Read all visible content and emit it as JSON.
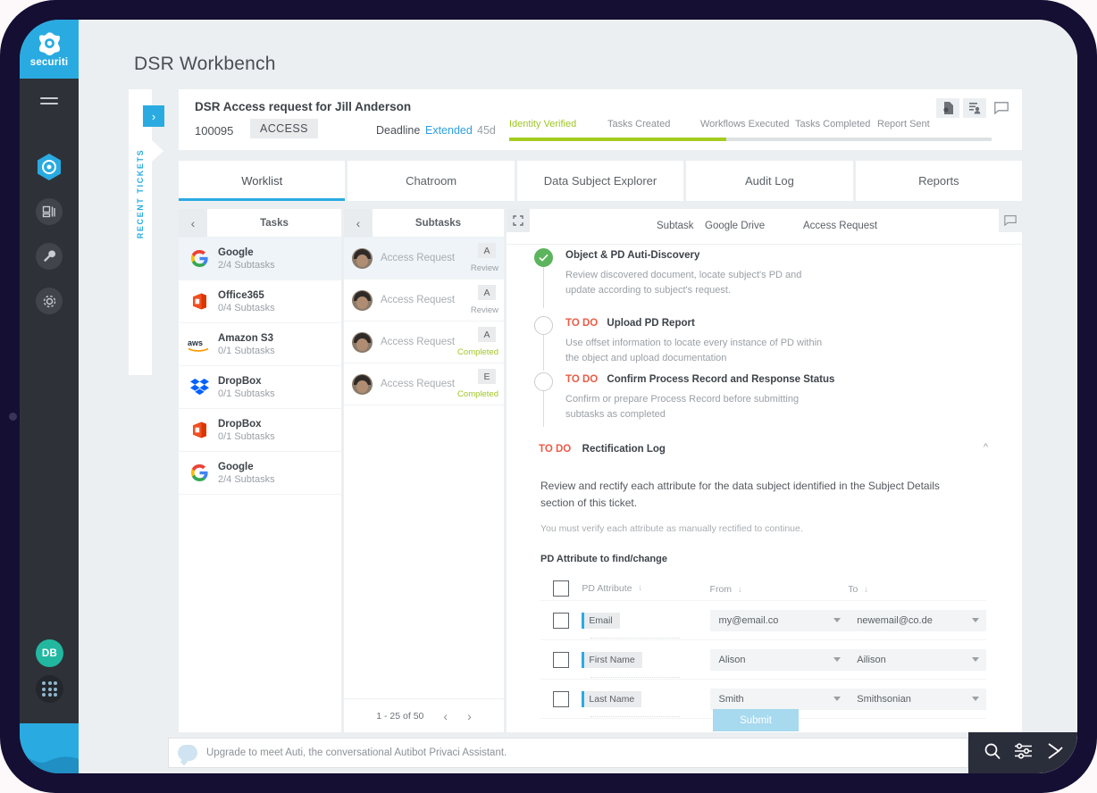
{
  "brand": {
    "name": "securiti",
    "logo_icon": "securiti-logo-icon"
  },
  "sidebar": {
    "menu_icon": "hamburger-menu-icon",
    "items": [
      {
        "icon": "privaci-hexagon-icon",
        "active": true
      },
      {
        "icon": "dashboard-icon",
        "active": false
      },
      {
        "icon": "wrench-icon",
        "active": false
      },
      {
        "icon": "gear-icon",
        "active": false
      }
    ],
    "avatar_initials": "DB",
    "apps_icon": "apps-grid-icon"
  },
  "page": {
    "title": "DSR Workbench"
  },
  "rail": {
    "label": "RECENT TICKETS",
    "expand_icon": "chevron-right-icon"
  },
  "ticket": {
    "title": "DSR Access request for Jill Anderson",
    "id": "100095",
    "type": "ACCESS",
    "deadline_label": "Deadline",
    "deadline_state": "Extended",
    "deadline_days": "45d",
    "icons": [
      "document-settings-icon",
      "assign-user-icon",
      "comment-icon"
    ],
    "stepper": {
      "steps": [
        {
          "label": "Identity Verified",
          "done": true
        },
        {
          "label": "Tasks Created",
          "done": false
        },
        {
          "label": "Workflows Executed",
          "done": false
        },
        {
          "label": "Tasks Completed",
          "done": false
        },
        {
          "label": "Report Sent",
          "done": false
        }
      ],
      "progress_percent": 45
    }
  },
  "tabs": [
    {
      "label": "Worklist",
      "active": true
    },
    {
      "label": "Chatroom",
      "active": false
    },
    {
      "label": "Data Subject Explorer",
      "active": false
    },
    {
      "label": "Audit Log",
      "active": false
    },
    {
      "label": "Reports",
      "active": false
    }
  ],
  "tasks_panel": {
    "header": "Tasks",
    "back_icon": "chevron-left-icon",
    "rows": [
      {
        "name": "Google",
        "subtasks": "2/4 Subtasks",
        "icon": "google-icon",
        "selected": true
      },
      {
        "name": "Office365",
        "subtasks": "0/4 Subtasks",
        "icon": "office365-icon",
        "selected": false
      },
      {
        "name": "Amazon S3",
        "subtasks": "0/1 Subtasks",
        "icon": "aws-icon",
        "selected": false
      },
      {
        "name": "DropBox",
        "subtasks": "0/1 Subtasks",
        "icon": "dropbox-icon",
        "selected": false
      },
      {
        "name": "DropBox",
        "subtasks": "0/1 Subtasks",
        "icon": "office365-icon",
        "selected": false
      },
      {
        "name": "Google",
        "subtasks": "2/4 Subtasks",
        "icon": "google-icon",
        "selected": false
      }
    ]
  },
  "subtasks_panel": {
    "header": "Subtasks",
    "back_icon": "chevron-left-icon",
    "rows": [
      {
        "name": "Access Request",
        "badge": "A",
        "status": "Review",
        "done": false,
        "selected": true
      },
      {
        "name": "Access Request",
        "badge": "A",
        "status": "Review",
        "done": false,
        "selected": false
      },
      {
        "name": "Access Request",
        "badge": "A",
        "status": "Completed",
        "done": true,
        "selected": false
      },
      {
        "name": "Access Request",
        "badge": "E",
        "status": "Completed",
        "done": true,
        "selected": false
      }
    ],
    "pagination": {
      "range": "1 - 25 of 50",
      "prev_icon": "chevron-left-icon",
      "next_icon": "chevron-right-icon"
    }
  },
  "detail": {
    "expand_icon": "fullscreen-expand-icon",
    "chat_icon": "comment-icon",
    "breadcrumb": {
      "subtask": "Subtask",
      "source": "Google Drive",
      "type": "Access Request"
    },
    "checklist": [
      {
        "title": "Object & PD Auti-Discovery",
        "todo": "",
        "desc": "Review discovered document, locate subject's PD and update according to subject's request.",
        "done": true
      },
      {
        "title": "Upload PD Report",
        "todo": "TO DO",
        "desc": "Use offset information to locate every instance of PD within the object and upload documentation",
        "done": false
      },
      {
        "title": "Confirm Process Record and Response Status",
        "todo": "TO DO",
        "desc": "Confirm or prepare Process Record before submitting subtasks as completed",
        "done": false
      }
    ],
    "rectification": {
      "todo": "TO DO",
      "title": "Rectification Log",
      "collapse_icon": "chevron-up-icon",
      "paragraph": "Review and rectify each attribute for the data subject identified in the Subject Details section of this ticket.",
      "note": "You must verify each attribute as manually rectified to continue.",
      "table_label": "PD Attribute to find/change",
      "columns": [
        "PD Attribute",
        "From",
        "To"
      ],
      "rows": [
        {
          "attribute": "Email",
          "from": "my@email.co",
          "to": "newemail@co.de"
        },
        {
          "attribute": "First Name",
          "from": "Alison",
          "to": "Ailison"
        },
        {
          "attribute": "Last Name",
          "from": "Smith",
          "to": "Smithsonian"
        }
      ],
      "submit_label": "Submit"
    }
  },
  "chatbar": {
    "placeholder": "Upgrade to meet Auti, the conversational Autibot Privaci Assistant.",
    "actions": [
      "search-icon",
      "filter-sliders-icon",
      "send-arrow-icon"
    ]
  },
  "colors": {
    "brand_blue": "#29abe2",
    "accent_green": "#a4cc1f",
    "todo_red": "#ea5c48",
    "done_green": "#5cb45c",
    "bezel": "#140f33"
  }
}
